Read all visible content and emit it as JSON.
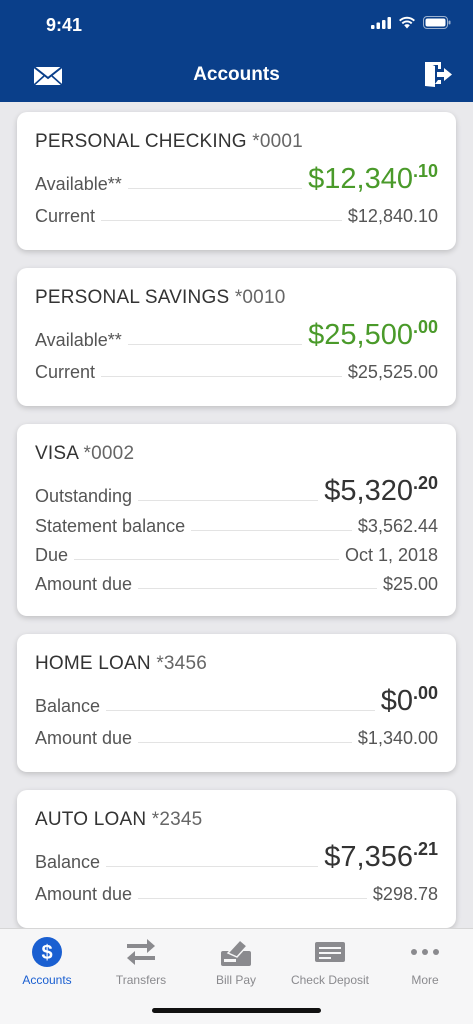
{
  "status": {
    "time": "9:41"
  },
  "nav": {
    "title": "Accounts"
  },
  "accounts": [
    {
      "name": "PERSONAL CHECKING",
      "number": "*0001",
      "primary": {
        "label": "Available**",
        "main": "$12,340",
        "cents": ".10",
        "color": "#4a9a2a"
      },
      "rows": [
        {
          "label": "Current",
          "value": "$12,840.10"
        }
      ]
    },
    {
      "name": "PERSONAL SAVINGS",
      "number": "*0010",
      "primary": {
        "label": "Available**",
        "main": "$25,500",
        "cents": ".00",
        "color": "#4a9a2a"
      },
      "rows": [
        {
          "label": "Current",
          "value": "$25,525.00"
        }
      ]
    },
    {
      "name": "VISA",
      "number": "*0002",
      "primary": {
        "label": "Outstanding",
        "main": "$5,320",
        "cents": ".20",
        "color": "#333333"
      },
      "rows": [
        {
          "label": "Statement balance",
          "value": "$3,562.44"
        },
        {
          "label": "Due",
          "value": "Oct 1, 2018"
        },
        {
          "label": "Amount due",
          "value": "$25.00"
        }
      ]
    },
    {
      "name": "HOME LOAN",
      "number": "*3456",
      "primary": {
        "label": "Balance",
        "main": "$0",
        "cents": ".00",
        "color": "#333333"
      },
      "rows": [
        {
          "label": "Amount due",
          "value": "$1,340.00"
        }
      ]
    },
    {
      "name": "AUTO LOAN",
      "number": "*2345",
      "primary": {
        "label": "Balance",
        "main": "$7,356",
        "cents": ".21",
        "color": "#333333"
      },
      "rows": [
        {
          "label": "Amount due",
          "value": "$298.78"
        }
      ]
    }
  ],
  "tabs": [
    {
      "label": "Accounts",
      "icon": "dollar-icon",
      "active": true
    },
    {
      "label": "Transfers",
      "icon": "transfer-arrows-icon",
      "active": false
    },
    {
      "label": "Bill Pay",
      "icon": "bill-pay-icon",
      "active": false
    },
    {
      "label": "Check Deposit",
      "icon": "check-icon",
      "active": false
    },
    {
      "label": "More",
      "icon": "more-dots-icon",
      "active": false
    }
  ]
}
